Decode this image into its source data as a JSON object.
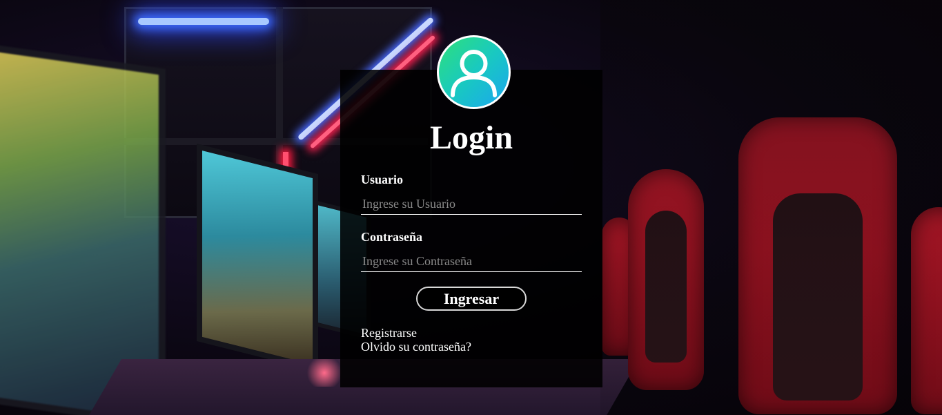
{
  "login": {
    "title": "Login",
    "username": {
      "label": "Usuario",
      "placeholder": "Ingrese su Usuario",
      "value": ""
    },
    "password": {
      "label": "Contraseña",
      "placeholder": "Ingrese su Contraseña",
      "value": ""
    },
    "submit_label": "Ingresar",
    "links": {
      "register": "Registrarse",
      "forgot_password": "Olvido su contraseña?"
    }
  },
  "icons": {
    "avatar": "user-icon"
  },
  "colors": {
    "panel_background": "#000000",
    "avatar_gradient_start": "#2ee07a",
    "avatar_gradient_end": "#1aa6f0",
    "text": "#ffffff",
    "placeholder": "#8a8a8a"
  }
}
